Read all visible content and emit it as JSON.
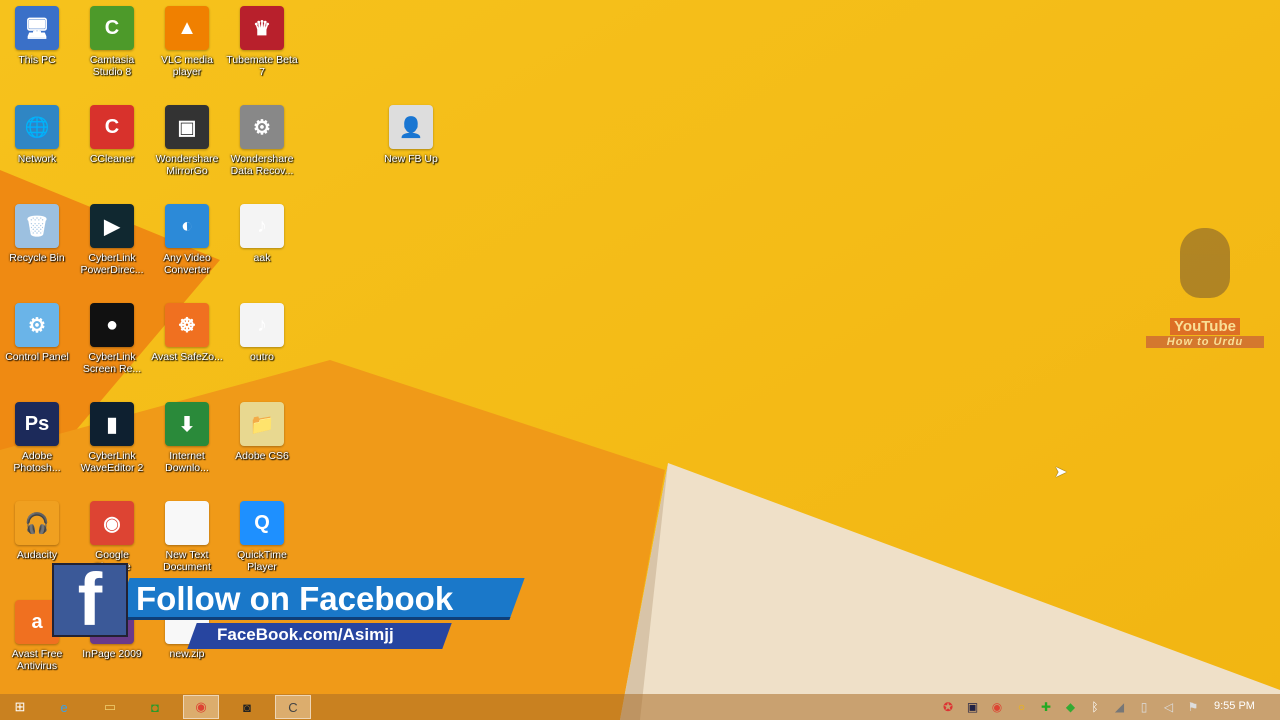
{
  "desktop": {
    "icons": [
      {
        "label": "This PC",
        "glyph": "🖥",
        "color": "#3a70c8",
        "col": 0,
        "row": 0
      },
      {
        "label": "Camtasia Studio 8",
        "glyph": "C",
        "color": "#4d9a2a",
        "col": 1,
        "row": 0
      },
      {
        "label": "VLC media player",
        "glyph": "▲",
        "color": "#f08000",
        "col": 2,
        "row": 0
      },
      {
        "label": "Tubemate Beta 7",
        "glyph": "♛",
        "color": "#b8202c",
        "col": 3,
        "row": 0
      },
      {
        "label": "Network",
        "glyph": "🌐",
        "color": "#2f86c4",
        "col": 0,
        "row": 1
      },
      {
        "label": "CCleaner",
        "glyph": "C",
        "color": "#d8322c",
        "col": 1,
        "row": 1
      },
      {
        "label": "Wondershare MirrorGo",
        "glyph": "▣",
        "color": "#333333",
        "col": 2,
        "row": 1
      },
      {
        "label": "Wondershare Data Recov...",
        "glyph": "⚙",
        "color": "#888888",
        "col": 3,
        "row": 1
      },
      {
        "label": "New FB Up",
        "glyph": "👤",
        "color": "#dddddd",
        "col": 5,
        "row": 1
      },
      {
        "label": "Recycle Bin",
        "glyph": "🗑",
        "color": "#9cc0e0",
        "col": 0,
        "row": 2
      },
      {
        "label": "CyberLink PowerDirec...",
        "glyph": "▶",
        "color": "#102830",
        "col": 1,
        "row": 2
      },
      {
        "label": "Any Video Converter",
        "glyph": "◐",
        "color": "#2c8ad8",
        "col": 2,
        "row": 2
      },
      {
        "label": "aak",
        "glyph": "♪",
        "color": "#f4f4f4",
        "col": 3,
        "row": 2
      },
      {
        "label": "Control Panel",
        "glyph": "⚙",
        "color": "#6ab4e8",
        "col": 0,
        "row": 3
      },
      {
        "label": "CyberLink Screen Re...",
        "glyph": "●",
        "color": "#111111",
        "col": 1,
        "row": 3
      },
      {
        "label": "Avast SafeZo...",
        "glyph": "☸",
        "color": "#f07020",
        "col": 2,
        "row": 3
      },
      {
        "label": "outro",
        "glyph": "♪",
        "color": "#f4f4f4",
        "col": 3,
        "row": 3
      },
      {
        "label": "Adobe Photosh...",
        "glyph": "Ps",
        "color": "#1c2a5a",
        "col": 0,
        "row": 4
      },
      {
        "label": "CyberLink WaveEditor 2",
        "glyph": "▮",
        "color": "#0e2030",
        "col": 1,
        "row": 4
      },
      {
        "label": "Internet Downlo...",
        "glyph": "⬇",
        "color": "#2a8a3a",
        "col": 2,
        "row": 4
      },
      {
        "label": "Adobe CS6",
        "glyph": "📁",
        "color": "#e8d890",
        "col": 3,
        "row": 4
      },
      {
        "label": "Audacity",
        "glyph": "🎧",
        "color": "#f0a020",
        "col": 0,
        "row": 5
      },
      {
        "label": "Google Chrome",
        "glyph": "◉",
        "color": "#dd4433",
        "col": 1,
        "row": 5
      },
      {
        "label": "New Text Document",
        "glyph": "",
        "color": "#f8f8f8",
        "col": 2,
        "row": 5
      },
      {
        "label": "QuickTime Player",
        "glyph": "Q",
        "color": "#1e90ff",
        "col": 3,
        "row": 5
      },
      {
        "label": "Avast Free Antivirus",
        "glyph": "a",
        "color": "#f07020",
        "col": 0,
        "row": 6
      },
      {
        "label": "InPage 2009",
        "glyph": "I",
        "color": "#6a3a8a",
        "col": 1,
        "row": 6
      },
      {
        "label": "new.zip",
        "glyph": "",
        "color": "#f8f8f8",
        "col": 2,
        "row": 6
      }
    ]
  },
  "overlay": {
    "title": "Follow on Facebook",
    "url": "FaceBook.com/Asimjj",
    "logo": "f"
  },
  "watermark": {
    "brand": "YouTube",
    "caption": "How to Urdu"
  },
  "taskbar": {
    "pinned": [
      {
        "name": "start-button",
        "glyph": "⊞",
        "color": "#ffffff"
      },
      {
        "name": "internet-explorer",
        "glyph": "e",
        "color": "#3aa0e8"
      },
      {
        "name": "file-explorer",
        "glyph": "▭",
        "color": "#f0d070"
      },
      {
        "name": "camtasia-recorder",
        "glyph": "◘",
        "color": "#2a9a2a"
      },
      {
        "name": "chrome",
        "glyph": "◉",
        "color": "#dd4433",
        "active": true
      },
      {
        "name": "screen-recorder",
        "glyph": "◙",
        "color": "#222222"
      },
      {
        "name": "camtasia-studio",
        "glyph": "C",
        "color": "#444444",
        "active": true
      }
    ],
    "tray": [
      {
        "name": "avast-tray",
        "glyph": "✪",
        "color": "#d33"
      },
      {
        "name": "display-tray",
        "glyph": "▣",
        "color": "#224"
      },
      {
        "name": "chrome-tray",
        "glyph": "◉",
        "color": "#d43"
      },
      {
        "name": "norton-tray",
        "glyph": "○",
        "color": "#f5b800"
      },
      {
        "name": "network-tray",
        "glyph": "✚",
        "color": "#2a2"
      },
      {
        "name": "security-tray",
        "glyph": "◆",
        "color": "#3a3"
      },
      {
        "name": "bluetooth-tray",
        "glyph": "ᛒ",
        "color": "#fff"
      },
      {
        "name": "signal-tray",
        "glyph": "◢",
        "color": "#777"
      },
      {
        "name": "battery-tray",
        "glyph": "▯",
        "color": "#ddd"
      },
      {
        "name": "volume-tray",
        "glyph": "◁",
        "color": "#ddd"
      },
      {
        "name": "action-center-tray",
        "glyph": "⚑",
        "color": "#ddd"
      }
    ],
    "clock": "9:55 PM"
  }
}
